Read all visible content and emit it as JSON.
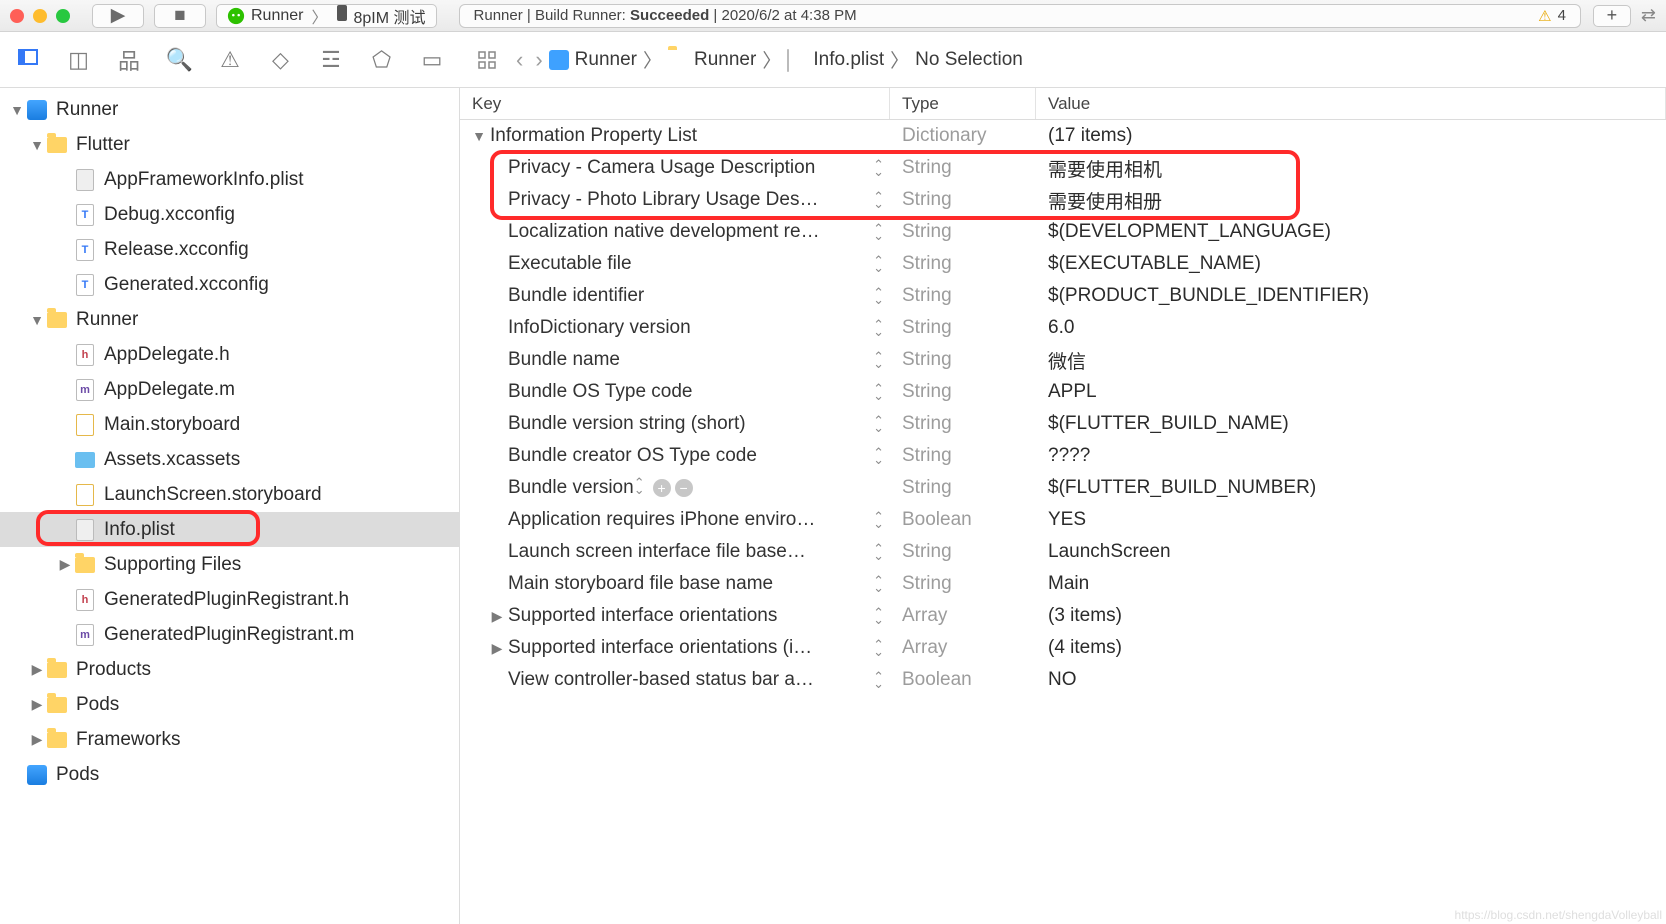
{
  "titlebar": {
    "scheme_app": "Runner",
    "scheme_device": "8pIM 测试",
    "status_prefix": "Runner | Build Runner:",
    "status_result": "Succeeded",
    "status_time": "| 2020/6/2 at 4:38 PM",
    "warn_count": "4"
  },
  "breadcrumb": {
    "items": [
      "Runner",
      "Runner",
      "Info.plist",
      "No Selection"
    ]
  },
  "columns": {
    "key": "Key",
    "type": "Type",
    "value": "Value"
  },
  "plist_root": {
    "label": "Information Property List",
    "type": "Dictionary",
    "value": "(17 items)"
  },
  "plist": [
    {
      "key": "Privacy - Camera Usage Description",
      "type": "String",
      "value": "需要使用相机",
      "hl": true
    },
    {
      "key": "Privacy - Photo Library Usage Des…",
      "type": "String",
      "value": "需要使用相册",
      "hl": true
    },
    {
      "key": "Localization native development re…",
      "type": "String",
      "value": "$(DEVELOPMENT_LANGUAGE)"
    },
    {
      "key": "Executable file",
      "type": "String",
      "value": "$(EXECUTABLE_NAME)"
    },
    {
      "key": "Bundle identifier",
      "type": "String",
      "value": "$(PRODUCT_BUNDLE_IDENTIFIER)"
    },
    {
      "key": "InfoDictionary version",
      "type": "String",
      "value": "6.0"
    },
    {
      "key": "Bundle name",
      "type": "String",
      "value": "微信"
    },
    {
      "key": "Bundle OS Type code",
      "type": "String",
      "value": "APPL"
    },
    {
      "key": "Bundle version string (short)",
      "type": "String",
      "value": "$(FLUTTER_BUILD_NAME)"
    },
    {
      "key": "Bundle creator OS Type code",
      "type": "String",
      "value": "????"
    },
    {
      "key": "Bundle version",
      "type": "String",
      "value": "$(FLUTTER_BUILD_NUMBER)",
      "ctl": true
    },
    {
      "key": "Application requires iPhone enviro…",
      "type": "Boolean",
      "value": "YES"
    },
    {
      "key": "Launch screen interface file base…",
      "type": "String",
      "value": "LaunchScreen"
    },
    {
      "key": "Main storyboard file base name",
      "type": "String",
      "value": "Main"
    },
    {
      "key": "Supported interface orientations",
      "type": "Array",
      "value": "(3 items)",
      "disc": "▶",
      "gray": true
    },
    {
      "key": "Supported interface orientations (i…",
      "type": "Array",
      "value": "(4 items)",
      "disc": "▶",
      "gray": true
    },
    {
      "key": "View controller-based status bar a…",
      "type": "Boolean",
      "value": "NO"
    }
  ],
  "tree": [
    {
      "ind": 0,
      "disc": "▼",
      "icon": "xcproj",
      "label": "Runner"
    },
    {
      "ind": 1,
      "disc": "▼",
      "icon": "folder",
      "label": "Flutter"
    },
    {
      "ind": 2,
      "disc": "",
      "icon": "plist",
      "label": "AppFrameworkInfo.plist"
    },
    {
      "ind": 2,
      "disc": "",
      "icon": "file-t",
      "t": "T",
      "label": "Debug.xcconfig"
    },
    {
      "ind": 2,
      "disc": "",
      "icon": "file-t",
      "t": "T",
      "label": "Release.xcconfig"
    },
    {
      "ind": 2,
      "disc": "",
      "icon": "file-t",
      "t": "T",
      "label": "Generated.xcconfig"
    },
    {
      "ind": 1,
      "disc": "▼",
      "icon": "folder",
      "label": "Runner"
    },
    {
      "ind": 2,
      "disc": "",
      "icon": "file-h",
      "t": "h",
      "label": "AppDelegate.h"
    },
    {
      "ind": 2,
      "disc": "",
      "icon": "file-m",
      "t": "m",
      "label": "AppDelegate.m"
    },
    {
      "ind": 2,
      "disc": "",
      "icon": "sb",
      "label": "Main.storyboard"
    },
    {
      "ind": 2,
      "disc": "",
      "icon": "assets",
      "label": "Assets.xcassets"
    },
    {
      "ind": 2,
      "disc": "",
      "icon": "sb",
      "label": "LaunchScreen.storyboard"
    },
    {
      "ind": 2,
      "disc": "",
      "icon": "plist",
      "label": "Info.plist",
      "sel": true
    },
    {
      "ind": 2,
      "disc": "▶",
      "icon": "folder",
      "label": "Supporting Files"
    },
    {
      "ind": 2,
      "disc": "",
      "icon": "file-h",
      "t": "h",
      "label": "GeneratedPluginRegistrant.h"
    },
    {
      "ind": 2,
      "disc": "",
      "icon": "file-m",
      "t": "m",
      "label": "GeneratedPluginRegistrant.m"
    },
    {
      "ind": 1,
      "disc": "▶",
      "icon": "folder",
      "label": "Products"
    },
    {
      "ind": 1,
      "disc": "▶",
      "icon": "folder",
      "label": "Pods"
    },
    {
      "ind": 1,
      "disc": "▶",
      "icon": "folder",
      "label": "Frameworks"
    },
    {
      "ind": 0,
      "disc": "",
      "icon": "xcproj",
      "label": "Pods"
    }
  ],
  "watermark": "https://blog.csdn.net/shengdaVolleyball"
}
